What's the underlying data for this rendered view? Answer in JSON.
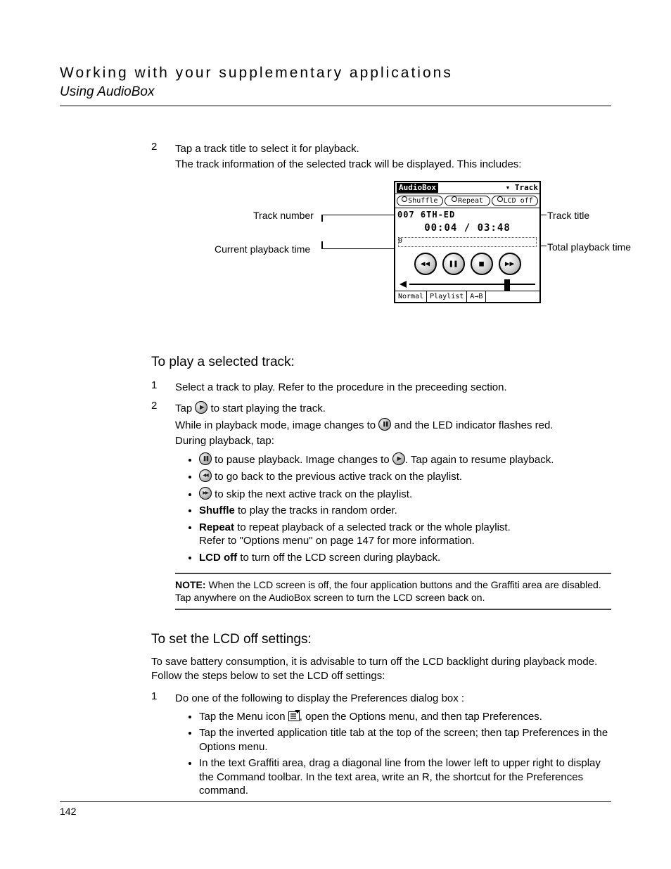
{
  "header": {
    "title": "Working with your supplementary applications",
    "subtitle": "Using AudioBox"
  },
  "step2": {
    "num": "2",
    "line1": "Tap a track title to select it for playback.",
    "line2": "The track information of the selected track will be displayed. This includes:"
  },
  "diagram": {
    "callout_tracknum": "Track number",
    "callout_curtime": "Current playback time",
    "callout_title": "Track title",
    "callout_total": "Total playback time",
    "device": {
      "app": "AudioBox",
      "menu": "Track",
      "btn_shuffle": "Shuffle",
      "btn_repeat": "Repeat",
      "btn_lcdoff": "LCD off",
      "track_text": "007 6TH-ED",
      "time_text": "00:04 / 03:48",
      "footer_normal": "Normal",
      "footer_playlist": "Playlist",
      "footer_ab": "A→B"
    }
  },
  "sectionPlay": {
    "heading": "To play a selected track:",
    "s1_num": "1",
    "s1_text": "Select a track to play. Refer to the procedure in the preceeding section.",
    "s2_num": "2",
    "s2_a": "Tap ",
    "s2_b": " to start playing the track.",
    "s2_c1": "While in playback mode, image changes to ",
    "s2_c2": " and the LED indicator flashes red.",
    "s2_d": "During playback, tap:",
    "b1a": " to pause playback. Image changes to ",
    "b1b": ". Tap again to resume playback.",
    "b2": " to go back to the previous active track on the playlist.",
    "b3": " to skip the next active track on the playlist.",
    "b4_bold": "Shuffle",
    "b4": " to play the tracks in random order.",
    "b5_bold": "Repeat",
    "b5a": " to repeat playback of a selected track or the whole playlist.",
    "b5b": "Refer to \"Options menu\" on page 147 for more information.",
    "b6_bold": "LCD off",
    "b6": " to turn off the LCD screen during playback."
  },
  "note": {
    "label": "NOTE:",
    "text": "When the LCD screen is off, the four application buttons and the Graffiti area are disabled. Tap anywhere on the AudioBox screen to turn the LCD screen back on."
  },
  "sectionLCD": {
    "heading": "To set the LCD off settings:",
    "intro": "To save battery consumption, it is advisable to turn off the LCD backlight during playback mode. Follow the steps below to set the LCD off settings:",
    "s1_num": "1",
    "s1_text": "Do one of the following to display the Preferences dialog box :",
    "b1a": "Tap the Menu icon ",
    "b1b": ", open the Options menu, and then tap Preferences.",
    "b2": "Tap the inverted application title tab at the top of the screen; then tap Preferences in the Options menu.",
    "b3": "In the text Graffiti area, drag a diagonal line from the lower left to upper right to display the Command toolbar. In the text area, write an R, the shortcut for the Preferences command."
  },
  "pagenum": "142"
}
